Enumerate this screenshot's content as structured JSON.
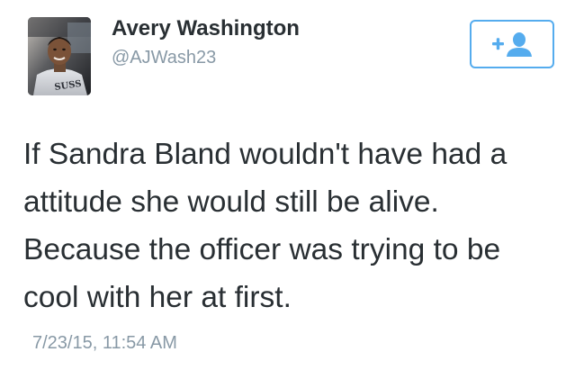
{
  "tweet": {
    "user": {
      "display_name": "Avery Washington",
      "handle": "@AJWash23",
      "avatar": "profile-photo",
      "avatar_shirt_text": "SUSS"
    },
    "follow_button": {
      "icon": "add-user-icon",
      "color": "#55acee"
    },
    "text_lines": [
      "If Sandra Bland wouldn't have had a",
      "attitude she would still be alive.",
      "Because the officer was trying to be",
      "cool with her at first."
    ],
    "timestamp": "7/23/15, 11:54 AM"
  }
}
